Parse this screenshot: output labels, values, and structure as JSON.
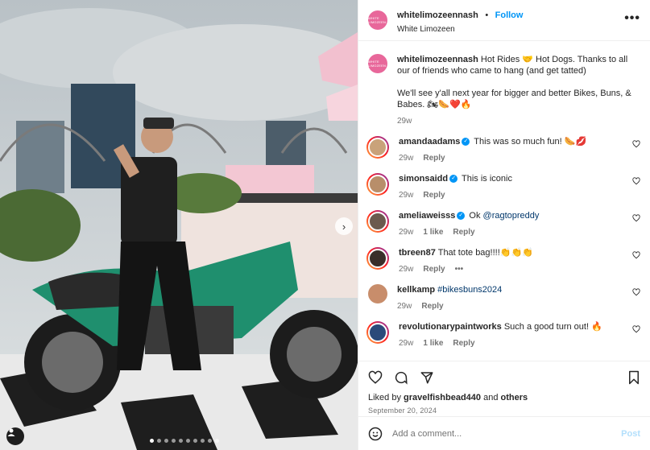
{
  "post": {
    "dots_count": 10,
    "active_dot": 0
  },
  "header": {
    "username": "whitelimozeennash",
    "separator": "•",
    "follow_label": "Follow",
    "subtitle": "White Limozeen",
    "more_label": "•••"
  },
  "caption": {
    "username": "whitelimozeennash",
    "line1": "Hot Rides 🤝 Hot Dogs. Thanks to all our of friends who came to hang (and get tatted)",
    "line2": "We'll see y'all next year for bigger and better Bikes, Buns, & Babes. 🏍🌭❤️🔥",
    "time": "29w"
  },
  "comments": [
    {
      "username": "amandaadams",
      "verified": true,
      "text": "This was so much fun! 🌭💋",
      "time": "29w",
      "likes": "",
      "reply": "Reply",
      "ring": true,
      "avatar_color": "#c9a27a"
    },
    {
      "username": "simonsaidd",
      "verified": true,
      "text": "This is iconic",
      "time": "29w",
      "likes": "",
      "reply": "Reply",
      "ring": true,
      "avatar_color": "#b88e6a"
    },
    {
      "username": "ameliaweisss",
      "verified": true,
      "mention": "@ragtopreddy",
      "text": "Ok ",
      "time": "29w",
      "likes": "1 like",
      "reply": "Reply",
      "ring": true,
      "avatar_color": "#6b5a4e"
    },
    {
      "username": "tbreen87",
      "verified": false,
      "text": "That tote bag!!!!👏👏👏",
      "time": "29w",
      "likes": "",
      "reply": "Reply",
      "more": "•••",
      "ring": true,
      "avatar_color": "#3a2f2a"
    },
    {
      "username": "kellkamp",
      "verified": false,
      "hashtag": "#bikesbuns2024",
      "text": "",
      "time": "29w",
      "likes": "",
      "reply": "Reply",
      "ring": false,
      "avatar_color": "#c88d6b"
    },
    {
      "username": "revolutionarypaintworks",
      "verified": false,
      "text": "Such a good turn out! 🔥",
      "time": "29w",
      "likes": "1 like",
      "reply": "Reply",
      "ring": true,
      "avatar_color": "#2b4a7a"
    }
  ],
  "footer": {
    "liked_prefix": "Liked by",
    "liked_user": "gravelfishbead440",
    "liked_and": "and",
    "liked_others": "others",
    "date": "September 20, 2024",
    "add_placeholder": "Add a comment...",
    "post_label": "Post"
  },
  "colors": {
    "accent": "#0095f6",
    "brand_avatar": "#e8679a",
    "muted": "#737373"
  },
  "icons": [
    "heart-icon",
    "comment-icon",
    "share-icon",
    "bookmark-icon",
    "emoji-icon",
    "chevron-right-icon",
    "user-tag-icon"
  ]
}
